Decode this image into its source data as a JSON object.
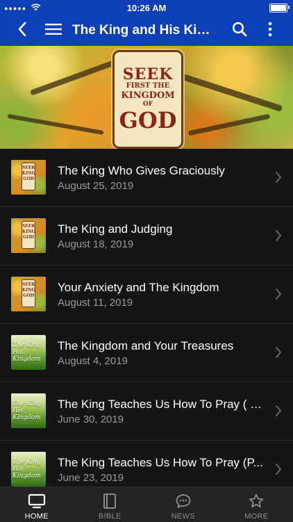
{
  "status_bar": {
    "carrier": "●●●●●",
    "time": "10:26 AM"
  },
  "app_bar": {
    "title": "The King and His Kingdo..."
  },
  "hero": {
    "sign_line1": "SEEK",
    "sign_line2": "FIRST THE",
    "sign_line3": "KINGDOM",
    "sign_line4": "OF",
    "sign_line5": "GOD"
  },
  "thumbs": {
    "seek_text": "SEEK KING GOD",
    "king_text": "The King His Kingdom"
  },
  "list": {
    "items": [
      {
        "title": "The King Who Gives Graciously",
        "date": "August 25, 2019",
        "thumb": "seek"
      },
      {
        "title": "The King and Judging",
        "date": "August 18, 2019",
        "thumb": "seek"
      },
      {
        "title": "Your Anxiety and The Kingdom",
        "date": "August 11, 2019",
        "thumb": "seek"
      },
      {
        "title": "The Kingdom and Your Treasures",
        "date": "August 4, 2019",
        "thumb": "king"
      },
      {
        "title": "The King Teaches Us How To Pray ( P...",
        "date": "June 30, 2019",
        "thumb": "king"
      },
      {
        "title": "The King Teaches Us How To Pray (P...",
        "date": "June 23, 2019",
        "thumb": "king"
      }
    ]
  },
  "tabs": [
    {
      "label": "HOME",
      "icon": "tv-icon",
      "active": true
    },
    {
      "label": "BIBLE",
      "icon": "book-icon",
      "active": false
    },
    {
      "label": "NEWS",
      "icon": "chat-bubble-icon",
      "active": false
    },
    {
      "label": "MORE",
      "icon": "star-icon",
      "active": false
    }
  ],
  "colors": {
    "accent": "#0d3fb8",
    "background": "#151515",
    "tab_bar": "#232323"
  }
}
